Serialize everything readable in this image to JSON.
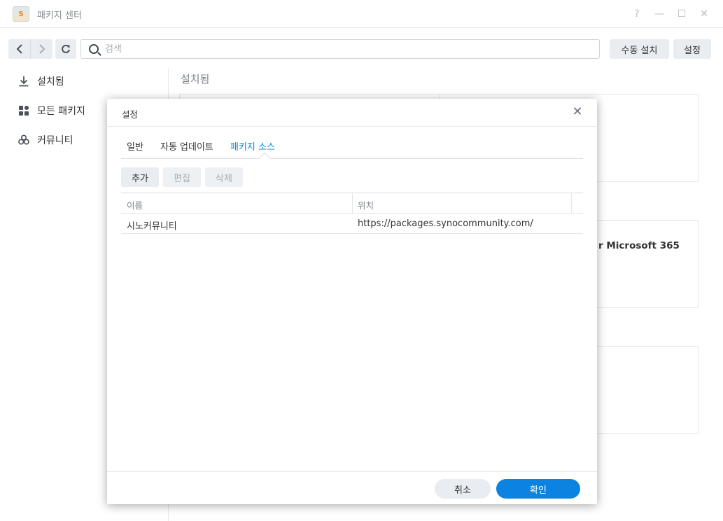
{
  "window": {
    "title": "패키지 센터",
    "controls": [
      "?",
      "—",
      "☐",
      "✕"
    ]
  },
  "toolbar": {
    "search_placeholder": "검색",
    "manual_install": "수동 설치",
    "settings": "설정"
  },
  "sidebar": {
    "items": [
      {
        "label": "설치됨",
        "icon": "download-icon"
      },
      {
        "label": "모든 패키지",
        "icon": "grid-icon"
      },
      {
        "label": "커뮤니티",
        "icon": "community-icon"
      }
    ]
  },
  "main": {
    "title": "설치됨",
    "partial_card_text": "r Microsoft 365"
  },
  "dialog": {
    "title": "설정",
    "tabs": [
      {
        "label": "일반",
        "active": false
      },
      {
        "label": "자동 업데이트",
        "active": false
      },
      {
        "label": "패키지 소스",
        "active": true
      }
    ],
    "actions": {
      "add": "추가",
      "edit": "편집",
      "delete": "삭제"
    },
    "columns": {
      "name": "이름",
      "location": "위치"
    },
    "rows": [
      {
        "name": "시노커뮤니티",
        "location": "https://packages.synocommunity.com/"
      }
    ],
    "cancel": "취소",
    "ok": "확인"
  },
  "colors": {
    "accent": "#0a84e0",
    "button_bg": "#e9edf2",
    "border": "#e3e6ea"
  }
}
